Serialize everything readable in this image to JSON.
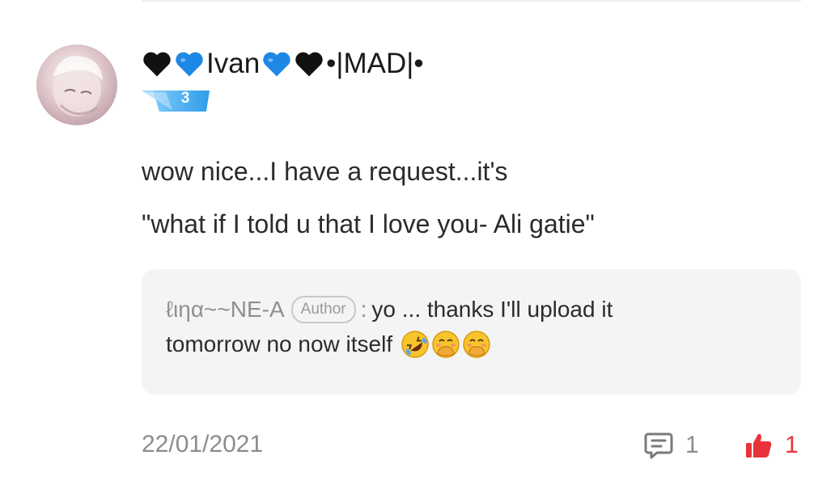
{
  "comment": {
    "username": {
      "segments": [
        "Ivan",
        "•|MAD|•"
      ]
    },
    "level": "3",
    "text_lines": [
      "wow nice...I have a request...it's",
      "\"what if I told u that I love you- Ali gatie\""
    ],
    "reply": {
      "author": "ℓιηα~~NE-A",
      "author_tag": "Author",
      "separator": ":",
      "text_line1": "yo ... thanks I'll upload it",
      "text_line2": "tomorrow no now itself"
    },
    "date": "22/01/2021",
    "reply_count": "1",
    "like_count": "1"
  },
  "colors": {
    "heart_black": "#111111",
    "heart_blue": "#1e88e5",
    "like_red": "#e8323c",
    "badge_blue": "#36a3f0"
  },
  "icons": {
    "username": [
      "black-heart-icon",
      "blue-heart-icon",
      "blue-heart-icon",
      "black-heart-icon"
    ],
    "reply_emojis": [
      "rolling-laughing-emoji-icon",
      "hand-over-mouth-emoji-icon",
      "hand-over-mouth-emoji-icon"
    ],
    "actions": [
      "comment-bubble-icon",
      "thumbs-up-icon"
    ]
  }
}
